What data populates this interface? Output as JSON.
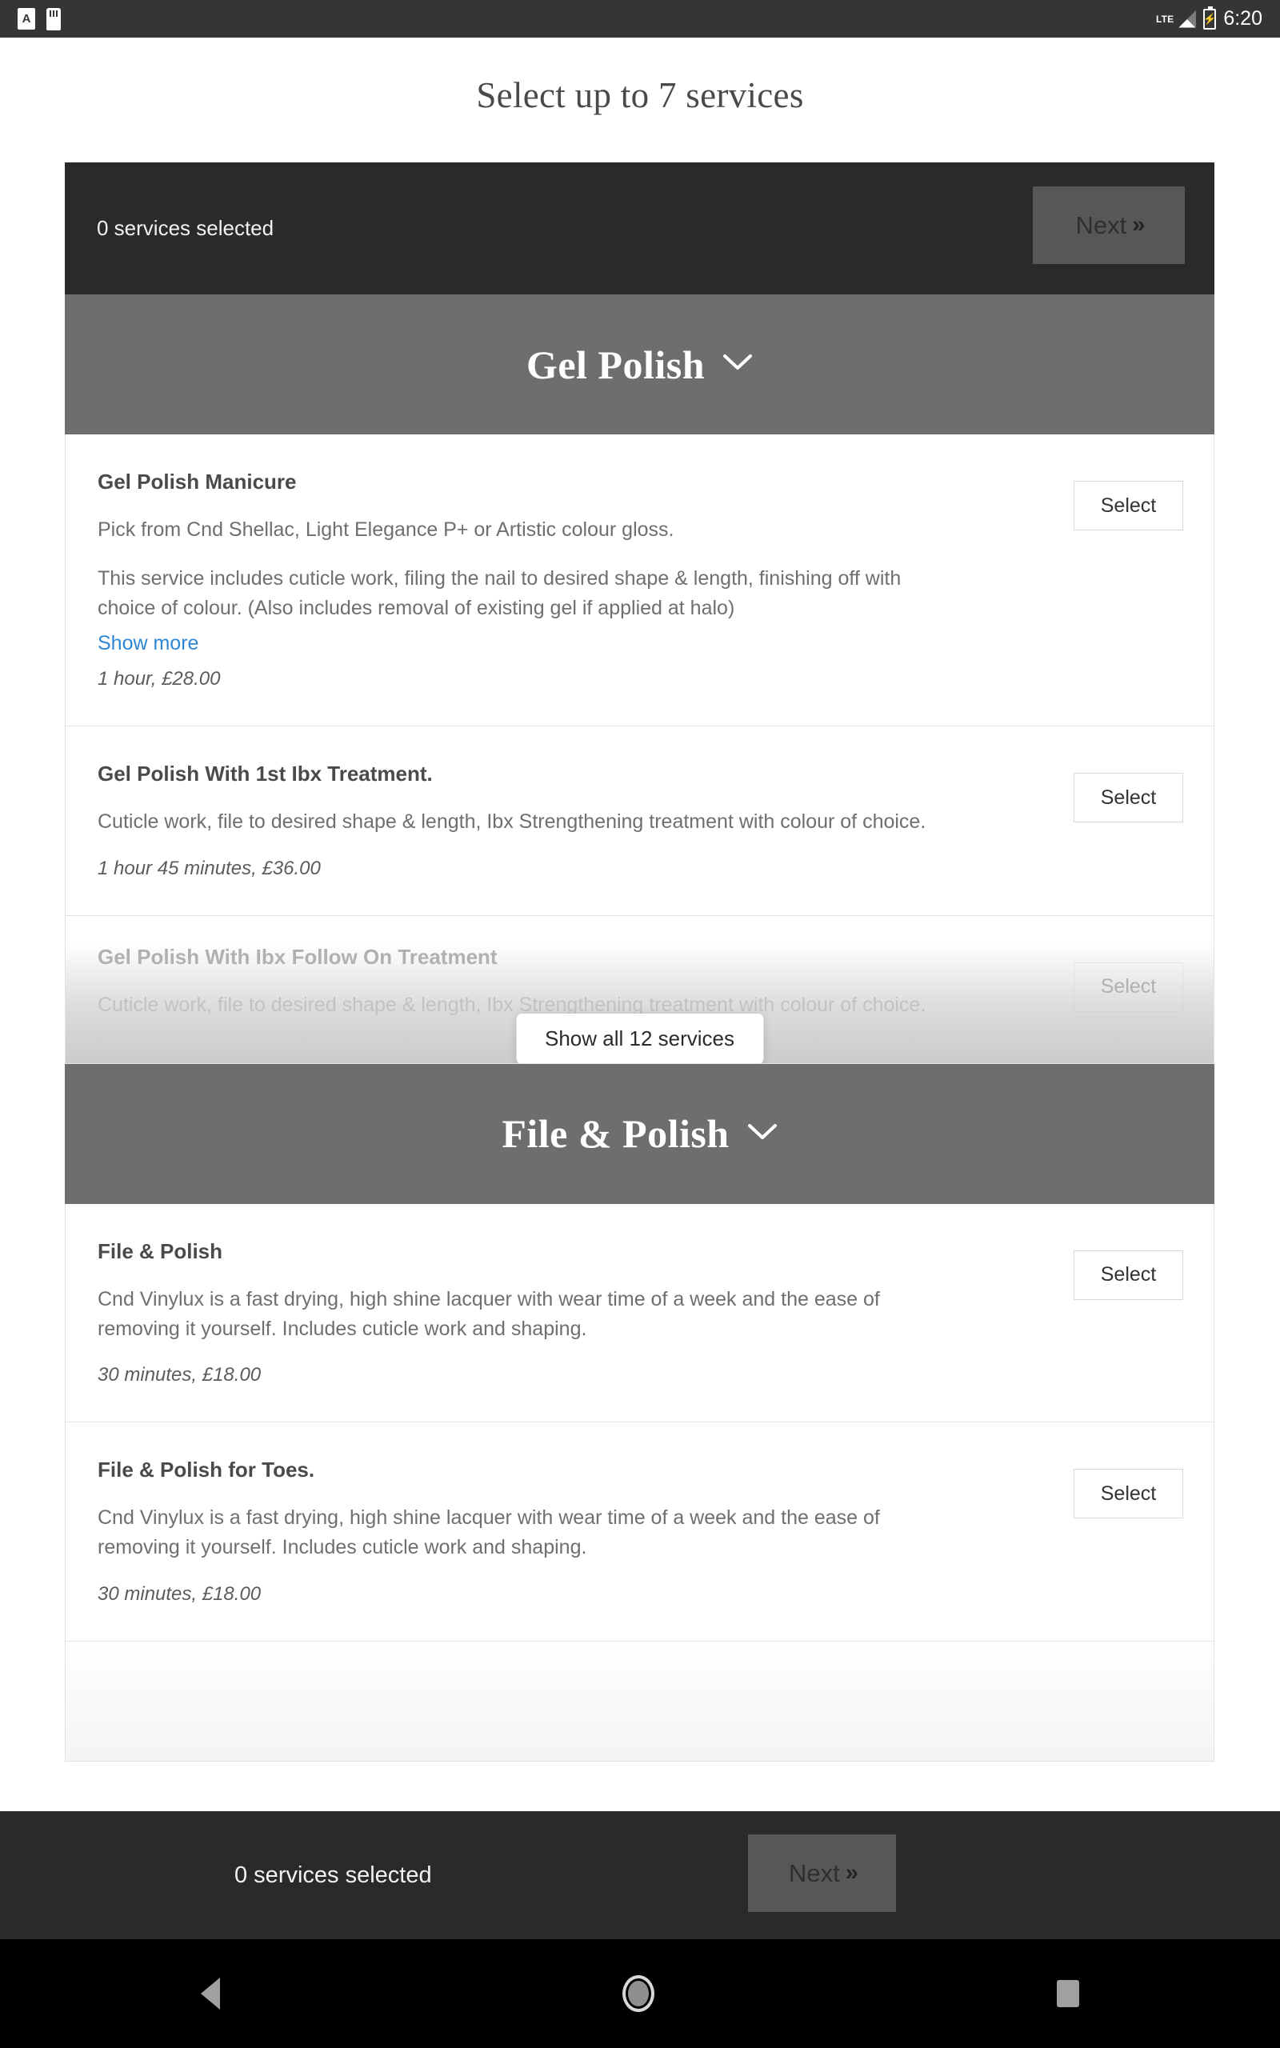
{
  "status_bar": {
    "icons": [
      "alarm-a-icon",
      "sd-card-icon"
    ],
    "network": "LTE",
    "battery_glyph": "⚡",
    "time": "6:20"
  },
  "page": {
    "title": "Select up to 7 services"
  },
  "selection_bar": {
    "summary": "0 services selected",
    "next_label": "Next",
    "next_chevron": "»"
  },
  "categories": [
    {
      "name": "Gel Polish",
      "chevron": "chevron-down-icon",
      "services": [
        {
          "name": "Gel Polish Manicure",
          "desc_1": "Pick from Cnd Shellac, Light Elegance P+ or Artistic colour gloss.",
          "desc_2": "This service includes cuticle work, filing the nail to desired shape & length, finishing off with choice of colour. (Also includes removal of existing gel if applied at halo)",
          "show_more": "Show more",
          "meta": "1 hour, £28.00",
          "select_label": "Select"
        },
        {
          "name": "Gel Polish With 1st Ibx Treatment.",
          "desc_1": "Cuticle work, file to desired shape & length, Ibx Strengthening treatment with colour of choice.",
          "meta": "1 hour 45 minutes, £36.00",
          "select_label": "Select"
        },
        {
          "name": "Gel Polish With Ibx Follow On Treatment",
          "desc_1": "Cuticle work, file to desired shape & length, Ibx Strengthening treatment with colour of choice.",
          "select_label": "Select"
        }
      ],
      "show_all_label": "Show all 12 services"
    },
    {
      "name": "File & Polish",
      "chevron": "chevron-down-icon",
      "services": [
        {
          "name": "File & Polish",
          "desc_1": "Cnd Vinylux is a fast drying, high shine lacquer with wear time of a week and the ease of removing it yourself. Includes cuticle work and shaping.",
          "meta": "30 minutes, £18.00",
          "select_label": "Select"
        },
        {
          "name": "File & Polish for Toes.",
          "desc_1": "Cnd Vinylux is a fast drying, high shine lacquer with wear time of a week and the ease of removing it yourself. Includes cuticle work and shaping.",
          "meta": "30 minutes, £18.00",
          "select_label": "Select"
        }
      ]
    }
  ],
  "bottom_bar": {
    "summary": "0 services selected",
    "next_label": "Next",
    "next_chevron": "»"
  },
  "nav_bar": {
    "back": "back-icon",
    "home": "home-icon",
    "recents": "recents-icon"
  },
  "colors": {
    "dark_bar": "#2a2a2a",
    "category_header": "#6e6e6e",
    "link_blue": "#2f86d4",
    "next_button": "#575757"
  }
}
